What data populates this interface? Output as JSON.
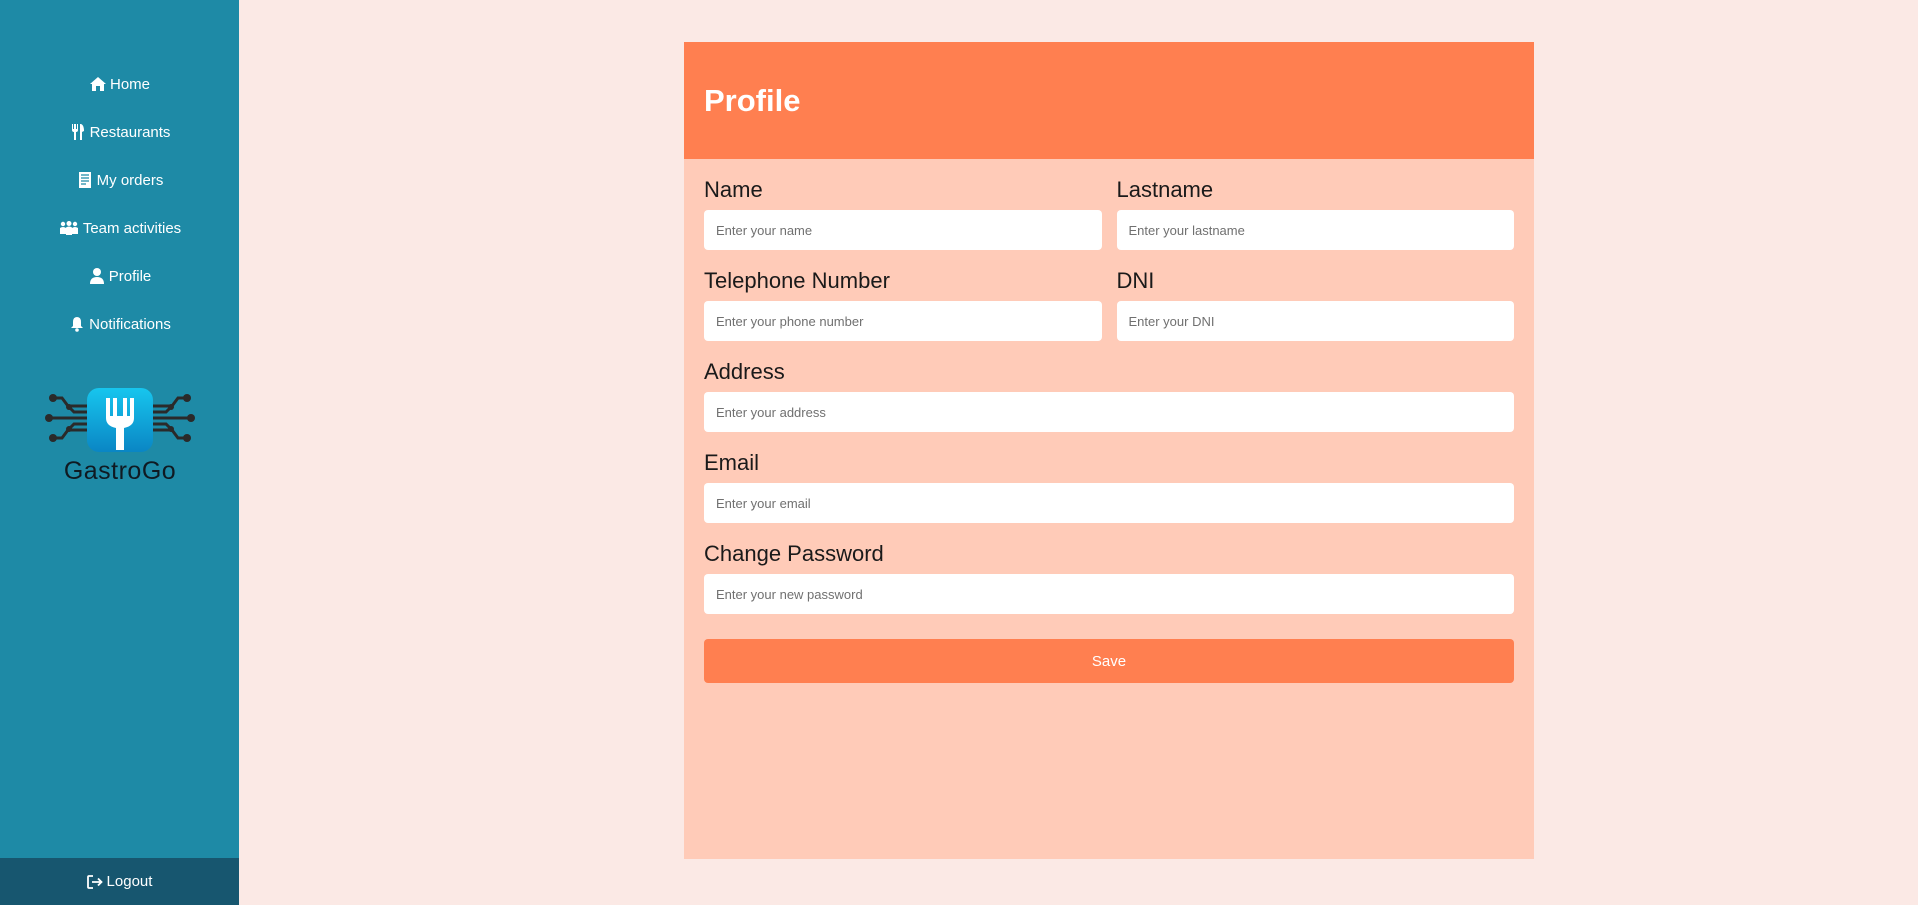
{
  "sidebar": {
    "items": [
      {
        "label": "Home",
        "icon": "home-icon"
      },
      {
        "label": "Restaurants",
        "icon": "utensils-icon"
      },
      {
        "label": "My orders",
        "icon": "receipt-icon"
      },
      {
        "label": "Team activities",
        "icon": "people-group-icon"
      },
      {
        "label": "Profile",
        "icon": "user-icon"
      },
      {
        "label": "Notifications",
        "icon": "bell-icon"
      }
    ],
    "brand": "GastroGo",
    "logout_label": "Logout",
    "logout_icon": "sign-out-icon"
  },
  "profile": {
    "title": "Profile",
    "fields": {
      "name": {
        "label": "Name",
        "placeholder": "Enter your name",
        "value": ""
      },
      "lastname": {
        "label": "Lastname",
        "placeholder": "Enter your lastname",
        "value": ""
      },
      "phone": {
        "label": "Telephone Number",
        "placeholder": "Enter your phone number",
        "value": ""
      },
      "dni": {
        "label": "DNI",
        "placeholder": "Enter your DNI",
        "value": ""
      },
      "address": {
        "label": "Address",
        "placeholder": "Enter your address",
        "value": ""
      },
      "email": {
        "label": "Email",
        "placeholder": "Enter your email",
        "value": ""
      },
      "password": {
        "label": "Change Password",
        "placeholder": "Enter your new password",
        "value": ""
      }
    },
    "save_label": "Save"
  },
  "colors": {
    "sidebar": "#1e8aa6",
    "logout_bg": "#17566f",
    "page_bg": "#fbe9e5",
    "card_bg": "#ffcbb8",
    "accent": "#ff7f50"
  }
}
